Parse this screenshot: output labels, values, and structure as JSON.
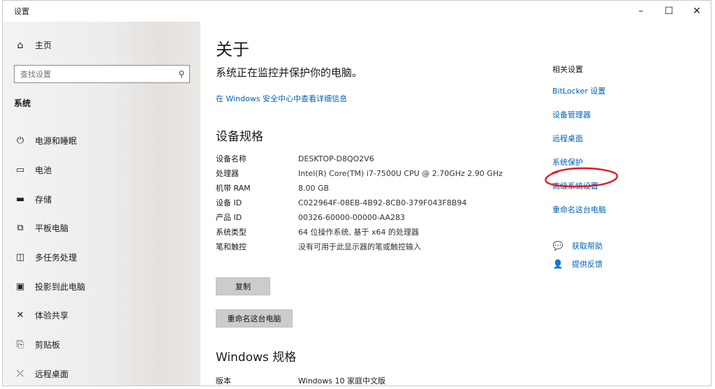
{
  "window": {
    "title": "设置",
    "controls": {
      "minimize": "–",
      "maximize": "☐",
      "close": "✕"
    }
  },
  "sidebar": {
    "home": {
      "label": "主页",
      "icon": "home-icon"
    },
    "search": {
      "placeholder": "查找设置"
    },
    "section": "系统",
    "items": [
      {
        "label": "电源和睡眠",
        "icon": "power-icon"
      },
      {
        "label": "电池",
        "icon": "battery-icon"
      },
      {
        "label": "存储",
        "icon": "storage-icon"
      },
      {
        "label": "平板电脑",
        "icon": "tablet-icon"
      },
      {
        "label": "多任务处理",
        "icon": "multitasking-icon"
      },
      {
        "label": "投影到此电脑",
        "icon": "projecting-icon"
      },
      {
        "label": "体验共享",
        "icon": "shared-experiences-icon"
      },
      {
        "label": "剪贴板",
        "icon": "clipboard-icon"
      },
      {
        "label": "远程桌面",
        "icon": "remote-desktop-icon"
      }
    ]
  },
  "main": {
    "title": "关于",
    "status": "系统正在监控并保护你的电脑。",
    "security_link": "在 Windows 安全中心中查看详细信息",
    "device_specs": {
      "heading": "设备规格",
      "rows": [
        {
          "key": "设备名称",
          "value": "DESKTOP-D8QO2V6"
        },
        {
          "key": "处理器",
          "value": "Intel(R) Core(TM) i7-7500U CPU @ 2.70GHz   2.90 GHz"
        },
        {
          "key": "机带 RAM",
          "value": "8.00 GB"
        },
        {
          "key": "设备 ID",
          "value": "C022964F-08EB-4B92-8CB0-379F043F8B94"
        },
        {
          "key": "产品 ID",
          "value": "00326-60000-00000-AA283"
        },
        {
          "key": "系统类型",
          "value": "64 位操作系统, 基于 x64 的处理器"
        },
        {
          "key": "笔和触控",
          "value": "没有可用于此显示器的笔或触控输入"
        }
      ]
    },
    "copy_button": "复制",
    "rename_button": "重命名这台电脑",
    "windows_specs": {
      "heading": "Windows 规格",
      "edition_key": "版本",
      "edition_value": "Windows 10 家庭中文版"
    }
  },
  "related": {
    "title": "相关设置",
    "links": [
      "BitLocker 设置",
      "设备管理器",
      "远程桌面",
      "系统保护",
      "高级系统设置",
      "重命名这台电脑"
    ],
    "help": [
      {
        "label": "获取帮助",
        "icon": "get-help-icon"
      },
      {
        "label": "提供反馈",
        "icon": "feedback-icon"
      }
    ]
  },
  "colors": {
    "link": "#0063b1",
    "annotation": "#e31b23",
    "button": "#cccccc"
  }
}
